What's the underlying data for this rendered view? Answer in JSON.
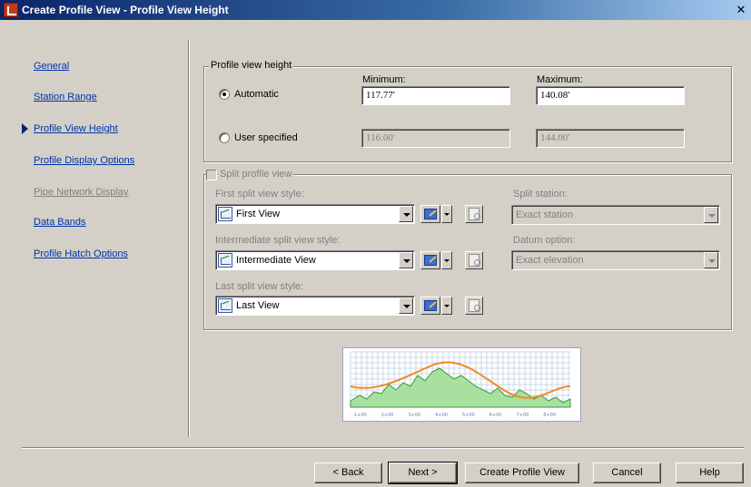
{
  "window": {
    "title": "Create Profile View - Profile View Height",
    "close_glyph": "✕"
  },
  "nav": {
    "items": [
      {
        "label": "General",
        "state": "link"
      },
      {
        "label": "Station Range",
        "state": "link"
      },
      {
        "label": "Profile View Height",
        "state": "current"
      },
      {
        "label": "Profile Display Options",
        "state": "link"
      },
      {
        "label": "Pipe Network Display",
        "state": "disabled"
      },
      {
        "label": "Data Bands",
        "state": "link"
      },
      {
        "label": "Profile Hatch Options",
        "state": "link"
      }
    ]
  },
  "height_group": {
    "legend": "Profile view height",
    "minimum_label": "Minimum:",
    "maximum_label": "Maximum:",
    "automatic_label": "Automatic",
    "automatic_selected": true,
    "automatic_min": "117.77'",
    "automatic_max": "140.08'",
    "user_label": "User specified",
    "user_selected": false,
    "user_min": "116.00'",
    "user_max": "144.00'"
  },
  "split_group": {
    "legend": "Split profile view",
    "checked": false,
    "first_label": "First split view style:",
    "first_value": "First View",
    "intermediate_label": "Intermediate split view style:",
    "intermediate_value": "Intermediate View",
    "last_label": "Last split view style:",
    "last_value": "Last View",
    "split_station_label": "Split station:",
    "split_station_value": "Exact station",
    "datum_label": "Datum option:",
    "datum_value": "Exact elevation"
  },
  "preview": {
    "station_labels": [
      "1+00",
      "2+00",
      "3+00",
      "4+00",
      "5+00",
      "6+00",
      "7+00",
      "8+00"
    ],
    "ground_color": "#3a9a3a",
    "grade_color": "#f08a20",
    "grid_color": "#c8d8e8"
  },
  "buttons": {
    "back": "< Back",
    "next": "Next >",
    "create": "Create Profile View",
    "cancel": "Cancel",
    "help": "Help"
  }
}
